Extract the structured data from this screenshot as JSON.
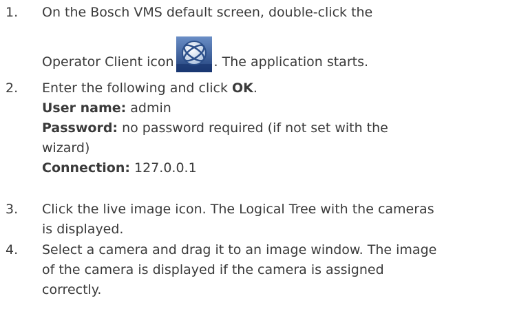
{
  "steps": [
    {
      "number": "1.",
      "line1": "On the Bosch VMS default screen, double-click the",
      "line2_before": "Operator Client icon",
      "line2_after": ". The application starts."
    },
    {
      "number": "2.",
      "intro_before": "Enter the following and click ",
      "intro_bold": "OK",
      "intro_after": ".",
      "user_label": "User name:",
      "user_value": " admin",
      "password_label": "Password:",
      "password_value_line1": " no password required (if not set with the",
      "password_value_line2": "wizard)",
      "connection_label": "Connection:",
      "connection_value": " 127.0.0.1"
    },
    {
      "number": "3.",
      "line1": "Click the live image icon. The Logical Tree with the cameras",
      "line2": "is displayed."
    },
    {
      "number": "4.",
      "line1": "Select a camera and drag it to an image window. The image",
      "line2": "of the camera is displayed if the camera is assigned",
      "line3": "correctly."
    }
  ],
  "icon": {
    "name": "operator-client-icon",
    "colors": {
      "bg_top": "#5b7fb8",
      "bg_bottom": "#1f3f7a",
      "globe": "#d8e4f2",
      "line": "#2c4f8a"
    }
  }
}
